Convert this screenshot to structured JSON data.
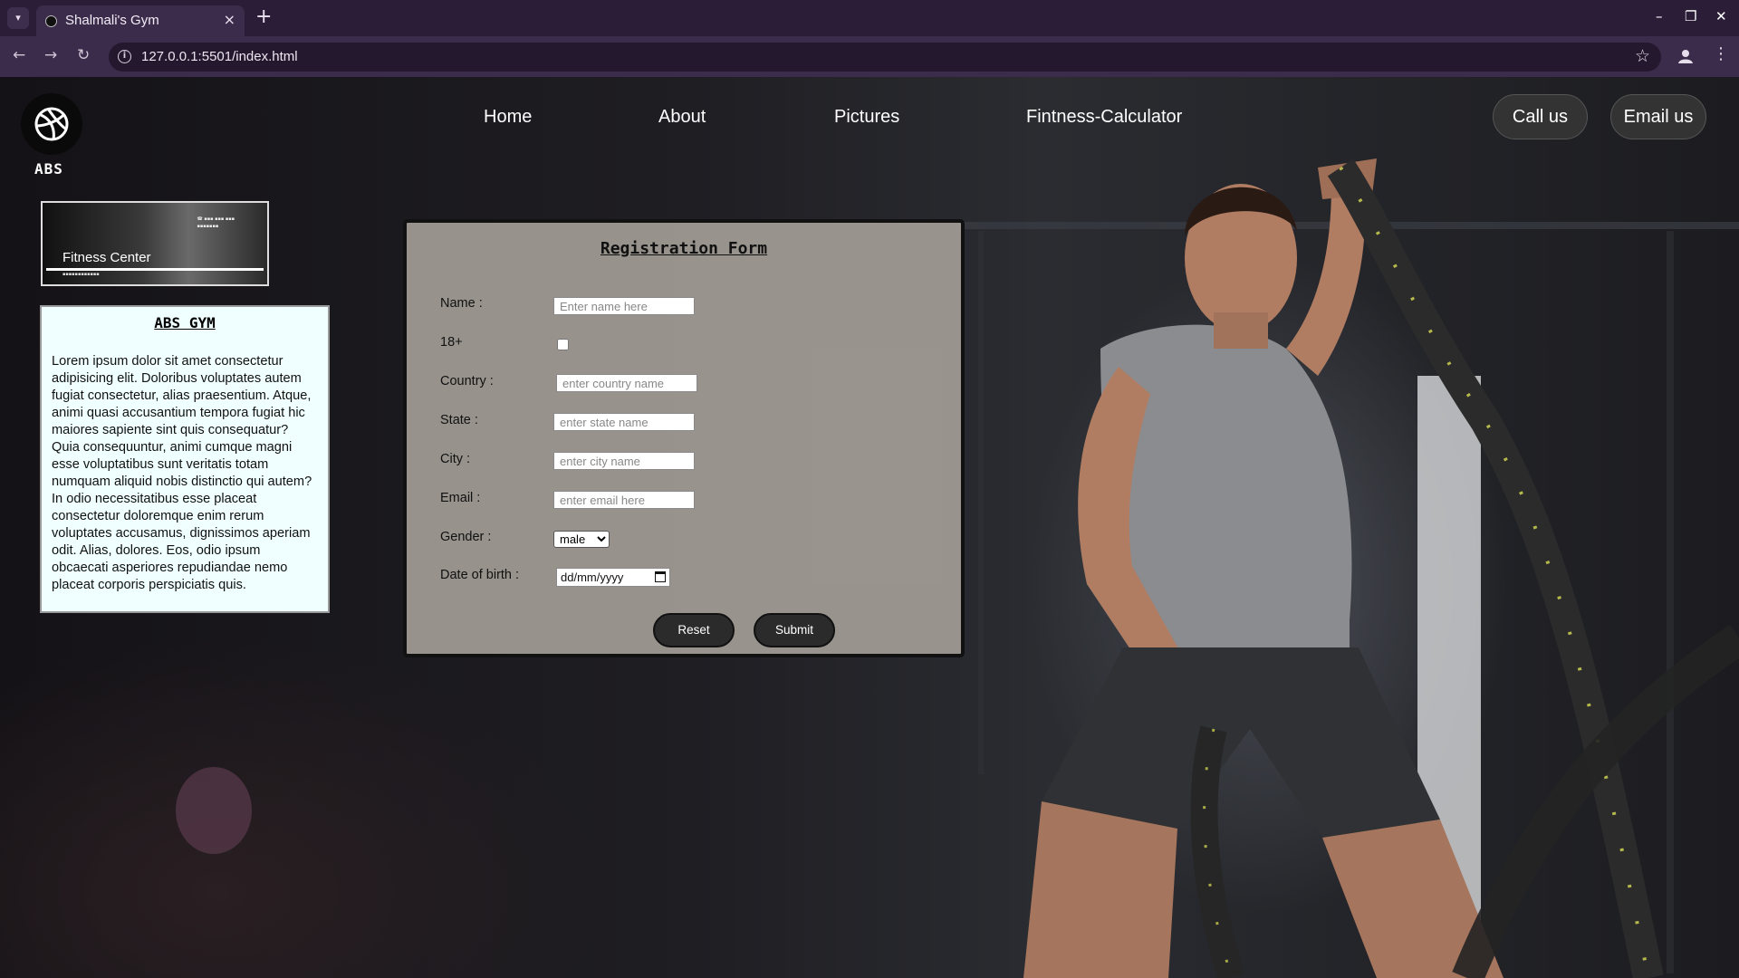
{
  "browser": {
    "tab_title": "Shalmali's Gym",
    "tab_close": "×",
    "new_tab": "+",
    "url": "127.0.0.1:5501/index.html",
    "window_controls": {
      "minimize": "–",
      "maximize": "❐",
      "close": "✕"
    }
  },
  "site": {
    "logo_text": "ABS",
    "nav": [
      "Home",
      "About",
      "Pictures",
      "Fintness-Calculator"
    ],
    "call_button": "Call us",
    "email_button": "Email us"
  },
  "banner": {
    "title": "Fitness Center"
  },
  "info_card": {
    "title": "ABS GYM",
    "body": "Lorem ipsum dolor sit amet consectetur adipisicing elit. Doloribus voluptates autem fugiat consectetur, alias praesentium. Atque, animi quasi accusantium tempora fugiat hic maiores sapiente sint quis consequatur? Quia consequuntur, animi cumque magni esse voluptatibus sunt veritatis totam numquam aliquid nobis distinctio qui autem? In odio necessitatibus esse placeat consectetur doloremque enim rerum voluptates accusamus, dignissimos aperiam odit. Alias, dolores. Eos, odio ipsum obcaecati asperiores repudiandae nemo placeat corporis perspiciatis quis."
  },
  "form": {
    "title": "Registration Form",
    "labels": {
      "name": "Name :",
      "adult": "18+",
      "country": "Country :",
      "state": "State :",
      "city": "City :",
      "email": "Email :",
      "gender": "Gender :",
      "dob": "Date of birth :"
    },
    "placeholders": {
      "name": "Enter name here",
      "country": "enter country name",
      "state": "enter state name",
      "city": "enter city name",
      "email": "enter email here"
    },
    "gender_selected": "male",
    "dob_value": "dd/mm/yyyy",
    "reset_label": "Reset",
    "submit_label": "Submit"
  },
  "icons": {
    "tab_list": "chevron-down-icon",
    "back": "arrow-left-icon",
    "forward": "arrow-right-icon",
    "reload": "reload-icon",
    "site_info": "info-icon",
    "bookmark": "star-icon",
    "profile": "profile-icon",
    "menu": "kebab-menu-icon",
    "logo": "volleyball-icon",
    "date": "calendar-icon"
  }
}
